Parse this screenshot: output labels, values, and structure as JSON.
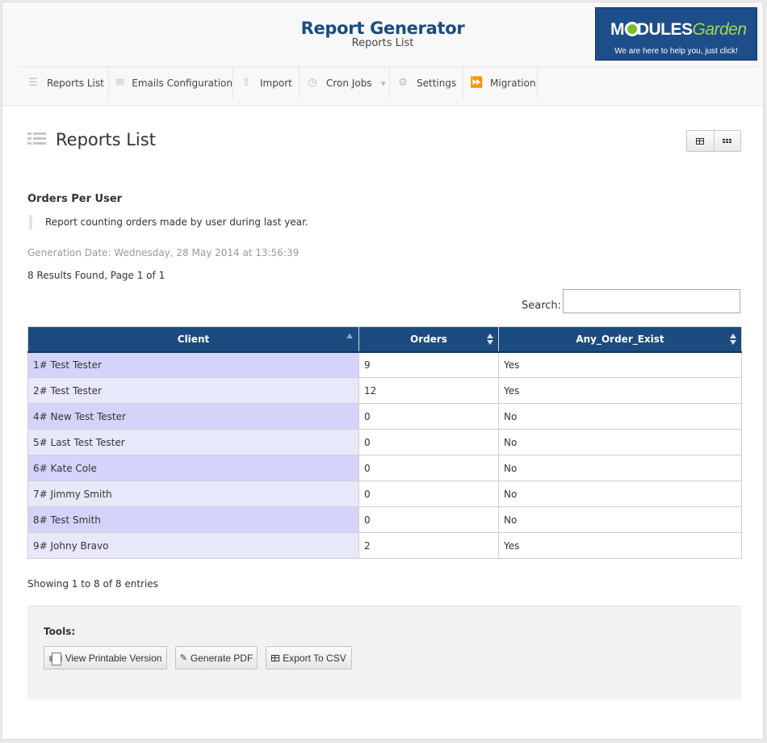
{
  "header": {
    "title": "Report Generator",
    "subtitle": "Reports List",
    "logo_word": "MODULES",
    "logo_word_accent": "Garden",
    "logo_tagline": "We are here to help you, just click!"
  },
  "nav": {
    "items": [
      {
        "label": "Reports List",
        "icon": "list-icon"
      },
      {
        "label": "Emails Configuration",
        "icon": "envelope-icon"
      },
      {
        "label": "Import",
        "icon": "share-icon"
      },
      {
        "label": "Cron Jobs",
        "icon": "clock-icon"
      },
      {
        "label": "Settings",
        "icon": "gears-icon"
      },
      {
        "label": "Migration",
        "icon": "fast-forward-icon"
      }
    ]
  },
  "page": {
    "title": "Reports List"
  },
  "report": {
    "name": "Orders Per User",
    "description": "Report counting orders made by user during last year.",
    "generation_date": "Generation Date: Wednesday, 28 May 2014 at 13:56:39",
    "results_summary": "8 Results Found, Page 1 of 1"
  },
  "search": {
    "label": "Search:",
    "value": ""
  },
  "table": {
    "columns": [
      "Client",
      "Orders",
      "Any_Order_Exist"
    ],
    "rows": [
      {
        "client": "1# Test Tester",
        "orders": "9",
        "exists": "Yes"
      },
      {
        "client": "2# Test Tester",
        "orders": "12",
        "exists": "Yes"
      },
      {
        "client": "4# New Test Tester",
        "orders": "0",
        "exists": "No"
      },
      {
        "client": "5# Last Test Tester",
        "orders": "0",
        "exists": "No"
      },
      {
        "client": "6# Kate Cole",
        "orders": "0",
        "exists": "No"
      },
      {
        "client": "7# Jimmy Smith",
        "orders": "0",
        "exists": "No"
      },
      {
        "client": "8# Test Smith",
        "orders": "0",
        "exists": "No"
      },
      {
        "client": "9# Johny Bravo",
        "orders": "2",
        "exists": "Yes"
      }
    ]
  },
  "footer": {
    "showing": "Showing 1 to 8 of 8 entries"
  },
  "tools": {
    "label": "Tools:",
    "print_label": "View Printable Version",
    "pdf_label": "Generate PDF",
    "csv_label": "Export To CSV"
  },
  "colors": {
    "brand_blue": "#1c4b7f",
    "title_blue": "#1b4b81",
    "logo_green": "#7dbb2b"
  }
}
